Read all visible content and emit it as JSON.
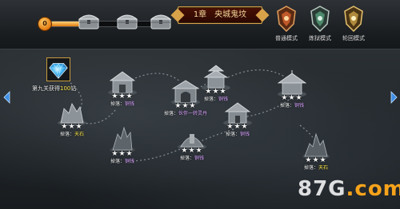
{
  "header": {
    "progress": {
      "count": "0",
      "fill_fraction": 0.35
    },
    "chests": [
      {
        "name": "chest-1"
      },
      {
        "name": "chest-2"
      },
      {
        "name": "chest-3"
      }
    ],
    "chapter_title": "1章　央城鬼坟",
    "modes": [
      {
        "label": "普通模式",
        "color": "#c0582a"
      },
      {
        "label": "炼狱模式",
        "color": "#4d8a6c"
      },
      {
        "label": "轮回模式",
        "color": "#b08a3c"
      }
    ]
  },
  "map": {
    "bonus": {
      "prefix": "第九关获得",
      "amount": "100",
      "suffix": "钻"
    },
    "nodes": [
      {
        "stars": "★★★",
        "drop_label": "掉落：",
        "drop_value": "铜钱",
        "kind": "copper"
      },
      {
        "stars": "★★★",
        "drop_label": "掉落：",
        "drop_value": "天石",
        "kind": "gem"
      },
      {
        "stars": "★★★",
        "drop_label": "掉落：",
        "drop_value": "铜钱",
        "kind": "copper"
      },
      {
        "stars": "★★★",
        "drop_label": "掉落：",
        "drop_value": "伙伴一转灵丹",
        "kind": "spirit"
      },
      {
        "stars": "★★★",
        "drop_label": "掉落：",
        "drop_value": "铜钱",
        "kind": "copper"
      },
      {
        "stars": "★★★",
        "drop_label": "掉落：",
        "drop_value": "铜钱",
        "kind": "copper"
      },
      {
        "stars": "★★★",
        "drop_label": "掉落：",
        "drop_value": "铜钱",
        "kind": "copper"
      },
      {
        "stars": "★★★",
        "drop_label": "掉落：",
        "drop_value": "铜钱",
        "kind": "copper"
      },
      {
        "stars": "★★★",
        "drop_label": "掉落：",
        "drop_value": "天石",
        "kind": "gem"
      }
    ]
  },
  "watermark": {
    "main": "87G",
    "suffix": ".com"
  }
}
